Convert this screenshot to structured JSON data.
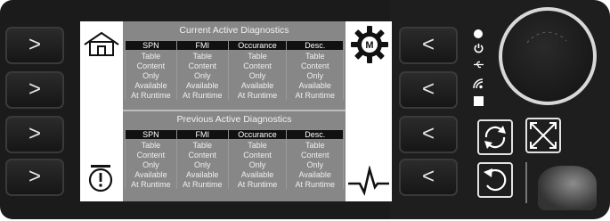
{
  "screen": {
    "current_panel": {
      "title": "Current Active Diagnostics",
      "columns": [
        "SPN",
        "FMI",
        "Occurance",
        "Desc."
      ],
      "rows": [
        [
          "Table",
          "Table",
          "Table",
          "Table"
        ],
        [
          "Content",
          "Content",
          "Content",
          "Content"
        ],
        [
          "Only",
          "Only",
          "Only",
          "Only"
        ],
        [
          "Available",
          "Available",
          "Available",
          "Available"
        ],
        [
          "At Runtime",
          "At Runtime",
          "At Runtime",
          "At Runtime"
        ]
      ]
    },
    "previous_panel": {
      "title": "Previous Active Diagnostics",
      "columns": [
        "SPN",
        "FMI",
        "Occurance",
        "Desc."
      ],
      "rows": [
        [
          "Table",
          "Table",
          "Table",
          "Table"
        ],
        [
          "Content",
          "Content",
          "Content",
          "Content"
        ],
        [
          "Only",
          "Only",
          "Only",
          "Only"
        ],
        [
          "Available",
          "Available",
          "Available",
          "Available"
        ],
        [
          "At Runtime",
          "At Runtime",
          "At Runtime",
          "At Runtime"
        ]
      ]
    },
    "icons": {
      "top_left": "home-icon",
      "bottom_left": "engine-warning-icon",
      "top_right": "gear-m-icon",
      "bottom_right": "pulse-icon"
    }
  },
  "softkeys": {
    "left": [
      ">",
      ">",
      ">",
      ">"
    ],
    "right": [
      "<",
      "<",
      "<",
      "<"
    ]
  },
  "colors": {
    "bezel": "#1b1b1b",
    "table_bg": "#878787",
    "header_bg": "#111111",
    "text": "#f0f0f0"
  }
}
